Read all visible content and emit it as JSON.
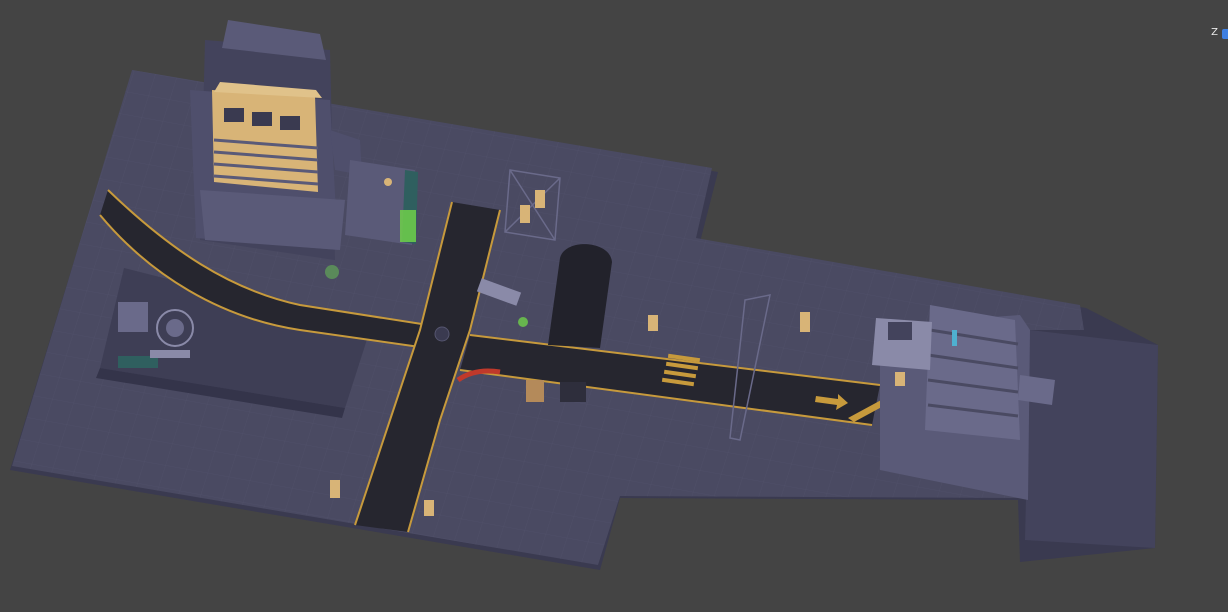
{
  "viewport": {
    "background": "#444444",
    "scene": "isometric-city-block"
  },
  "colors": {
    "ground": "#4a4a62",
    "ground_edge": "#3a3a50",
    "grid": "#55556f",
    "road": "#26262f",
    "road_line": "#c79a3c",
    "building": "#5a5a78",
    "building_dark": "#43435c",
    "building_light": "#6a6a8a",
    "accent_gold": "#d8b477",
    "accent_cyan": "#4fb0d0",
    "accent_green": "#6ed04a",
    "accent_red": "#c0392b"
  },
  "gizmo": {
    "axis_label": "Z",
    "axis_color": "#3f7fe0"
  }
}
